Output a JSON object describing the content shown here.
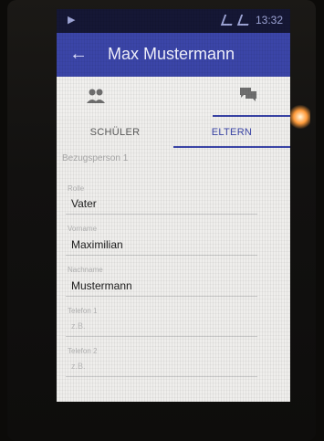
{
  "statusbar": {
    "left": "▶",
    "time": "13:32"
  },
  "appbar": {
    "back_icon": "←",
    "title": "Max Mustermann"
  },
  "icon_tabs": [
    {
      "icon": "people-icon",
      "active": false
    },
    {
      "icon": "chat-icon",
      "active": false
    },
    {
      "icon": "gear-icon",
      "active": true
    }
  ],
  "tabs": [
    {
      "label": "SCHÜLER",
      "selected": false
    },
    {
      "label": "ELTERN",
      "selected": true
    }
  ],
  "section_heading": "Bezugsperson 1",
  "fields": [
    {
      "label": "Rolle",
      "value": "Vater"
    },
    {
      "label": "Vorname",
      "value": "Maximilian"
    },
    {
      "label": "Nachname",
      "value": "Mustermann"
    },
    {
      "label": "Telefon 1",
      "value": "z.B."
    },
    {
      "label": "Telefon 2",
      "value": "z.B."
    }
  ],
  "colors": {
    "appbar": "#3b45a8",
    "statusbar": "#151735",
    "accent": "#3b45a8"
  }
}
